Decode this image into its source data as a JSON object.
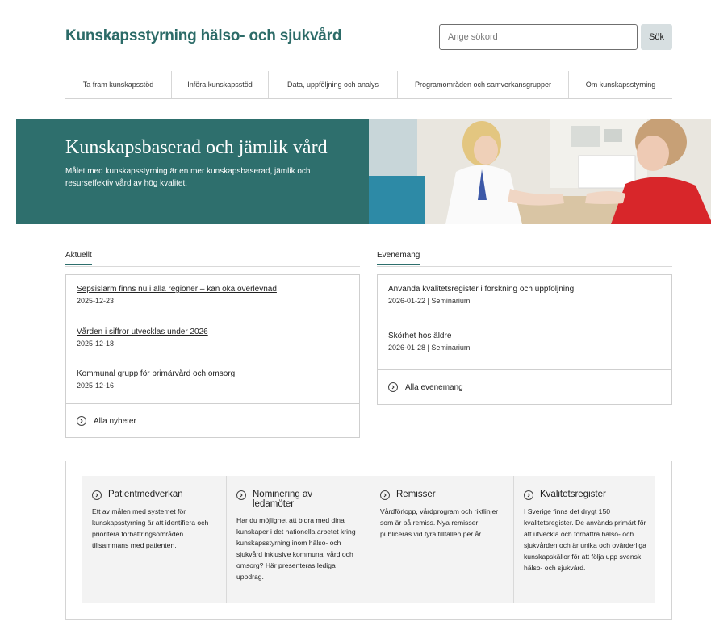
{
  "header": {
    "site_title": "Kunskapsstyrning hälso- och sjukvård",
    "search_placeholder": "Ange sökord",
    "search_button": "Sök"
  },
  "nav": {
    "items": [
      "Ta fram kunskapsstöd",
      "Införa kunskapsstöd",
      "Data, uppföljning och analys",
      "Programområden och samverkansgrupper",
      "Om kunskapsstyrning"
    ]
  },
  "hero": {
    "title": "Kunskapsbaserad och jämlik vård",
    "text": "Målet med kunskapsstyrning är en mer kunskapsbaserad, jämlik och resurseffektiv vård av hög kvalitet."
  },
  "news": {
    "heading": "Aktuellt",
    "items": [
      {
        "title": "Sepsislarm finns nu i alla regioner – kan öka överlevnad",
        "date": "2025-12-23"
      },
      {
        "title": "Vården i siffror utvecklas under 2026",
        "date": "2025-12-18"
      },
      {
        "title": "Kommunal grupp för primärvård och omsorg",
        "date": "2025-12-16"
      }
    ],
    "all_link": "Alla nyheter"
  },
  "events": {
    "heading": "Evenemang",
    "items": [
      {
        "title": "Använda kvalitetsregister i forskning och uppföljning",
        "meta": "2026-01-22 | Seminarium"
      },
      {
        "title": "Skörhet hos äldre",
        "meta": "2026-01-28 | Seminarium"
      }
    ],
    "all_link": "Alla evenemang"
  },
  "cards": [
    {
      "title": "Patientmedverkan",
      "text": "Ett av målen med systemet för kunskapsstyrning är att identifiera och prioritera förbättringsområden tillsammans med patienten."
    },
    {
      "title": "Nominering av ledamöter",
      "text": "Har du möjlighet att bidra med dina kunskaper i det nationella arbetet kring kunskapsstyrning inom hälso- och sjukvård inklusive kommunal vård och omsorg? Här presenteras lediga uppdrag."
    },
    {
      "title": "Remisser",
      "text": "Vårdförlopp, vårdprogram och riktlinjer som är på remiss. Nya remisser publiceras vid fyra tillfällen per år."
    },
    {
      "title": "Kvalitetsregister",
      "text": "I Sverige finns det drygt 150 kvalitetsregister. De används primärt för att utveckla och förbättra hälso- och sjukvården och är unika och ovärderliga kunskapskällor för att följa upp svensk hälso- och sjukvård."
    }
  ],
  "icons": {
    "circle_chevron": "chevron-right-circle-icon"
  },
  "colors": {
    "brand": "#2c6b68",
    "hero_bg": "#2e6f6d"
  }
}
